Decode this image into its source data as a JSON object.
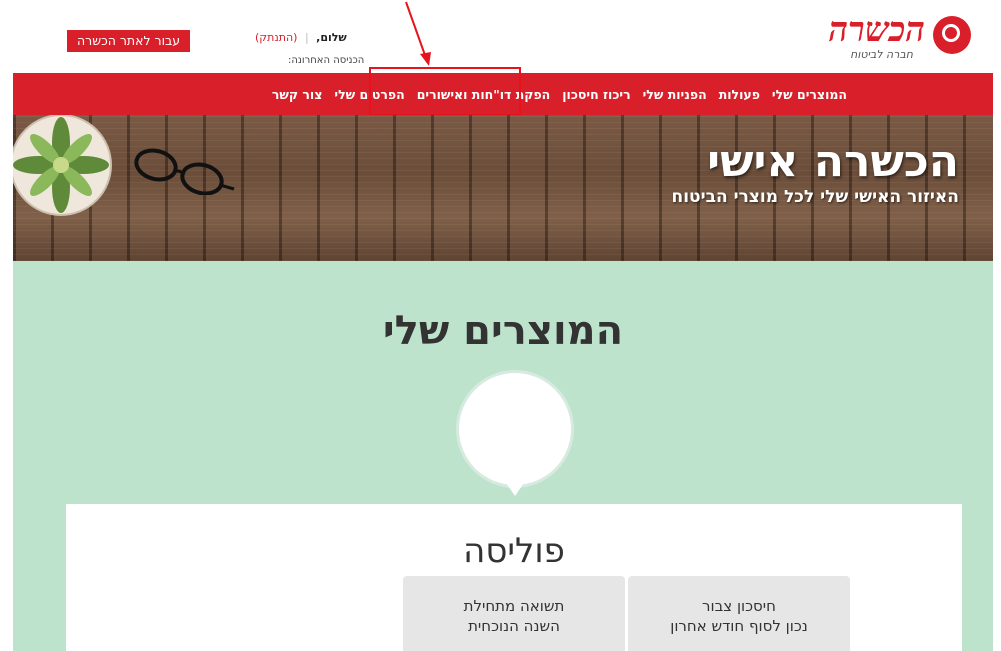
{
  "header": {
    "logo_text": "הכשרה",
    "logo_subtitle": "חברה לביטוח",
    "greeting": "שלום,",
    "logout_label": "(התנתק)",
    "last_login_label": "הכניסה האחרונה:",
    "site_button_label": "עבור לאתר הכשרה"
  },
  "nav": {
    "items": [
      {
        "label": "המוצרים שלי"
      },
      {
        "label": "פעולות"
      },
      {
        "label": "הפניות שלי"
      },
      {
        "label": "ריכוז חיסכון"
      },
      {
        "label": "הפקת דו\"חות ואישורים"
      },
      {
        "label": "הפרטים שלי"
      },
      {
        "label": "צור קשר"
      }
    ]
  },
  "hero": {
    "title": "הכשרה אישי",
    "subtitle": "האיזור האישי שלי לכל מוצרי הביטוח"
  },
  "products": {
    "title": "המוצרים שלי",
    "card_title": "פוליסה",
    "tiles": [
      {
        "line1": "חיסכון צבור",
        "line2": "נכון לסוף חודש אחרון"
      },
      {
        "line1": "תשואה מתחילת",
        "line2": "השנה הנוכחית"
      }
    ]
  },
  "colors": {
    "brand_red": "#d91f2a",
    "section_green": "#bde3cc",
    "annotation_red": "#e8121d"
  }
}
